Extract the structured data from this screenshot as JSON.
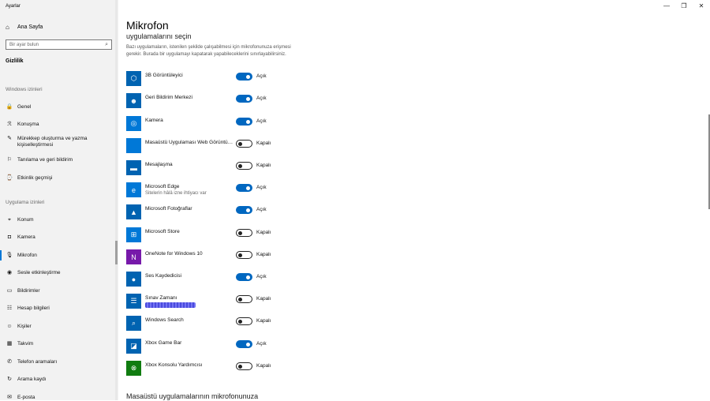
{
  "app_title": "Ayarlar",
  "sidebar": {
    "home_label": "Ana Sayfa",
    "search_placeholder": "Bir ayar bulun",
    "section": "Gizlilik",
    "group_windows": "Windows izinleri",
    "windows_items": [
      {
        "label": "Genel",
        "icon": "lock-icon"
      },
      {
        "label": "Konuşma",
        "icon": "speech-icon"
      },
      {
        "label": "Mürekkep oluşturma ve yazma kişiselleştirmesi",
        "icon": "pen-icon"
      },
      {
        "label": "Tanılama ve geri bildirim",
        "icon": "feedback-icon"
      },
      {
        "label": "Etkinlik geçmişi",
        "icon": "history-icon"
      }
    ],
    "group_apps": "Uygulama izinleri",
    "app_items": [
      {
        "label": "Konum",
        "icon": "location-icon"
      },
      {
        "label": "Kamera",
        "icon": "camera-icon"
      },
      {
        "label": "Mikrofon",
        "icon": "microphone-icon",
        "active": true
      },
      {
        "label": "Sesle etkinleştirme",
        "icon": "voice-icon"
      },
      {
        "label": "Bildirimler",
        "icon": "notification-icon"
      },
      {
        "label": "Hesap bilgileri",
        "icon": "account-icon"
      },
      {
        "label": "Kişiler",
        "icon": "contacts-icon"
      },
      {
        "label": "Takvim",
        "icon": "calendar-icon"
      },
      {
        "label": "Telefon aramaları",
        "icon": "phone-icon"
      },
      {
        "label": "Arama kaydı",
        "icon": "call-history-icon"
      },
      {
        "label": "E-posta",
        "icon": "mail-icon"
      }
    ]
  },
  "main": {
    "title": "Mikrofon",
    "section_head": "uygulamalarını seçin",
    "description": "Bazı uygulamaların, istenilen şekilde çalışabilmesi için mikrofonunuza erişmesi gerekir. Burada bir uygulamayı kapatarak yapabileceklerini sınırlayabilirsiniz.",
    "apps": [
      {
        "name": "3B Görüntüleyici",
        "state": "Açık",
        "on": true,
        "icon": "cube-icon",
        "color": "#0063b1"
      },
      {
        "name": "Geri Bildirim Merkezi",
        "state": "Açık",
        "on": true,
        "icon": "feedback-hub-icon",
        "color": "#0063b1"
      },
      {
        "name": "Kamera",
        "state": "Açık",
        "on": true,
        "icon": "camera-app-icon",
        "color": "#0078d7"
      },
      {
        "name": "Masaüstü Uygulaması Web Görüntü…",
        "state": "Kapalı",
        "on": false,
        "icon": "desktop-app-icon",
        "color": "#0078d7"
      },
      {
        "name": "Mesajlaşma",
        "state": "Kapalı",
        "on": false,
        "icon": "messaging-icon",
        "color": "#0063b1"
      },
      {
        "name": "Microsoft Edge",
        "sub": "Sitelerin hâlâ izne ihtiyacı var",
        "state": "Açık",
        "on": true,
        "icon": "edge-icon",
        "color": "#0078d7"
      },
      {
        "name": "Microsoft Fotoğraflar",
        "state": "Açık",
        "on": true,
        "icon": "photos-icon",
        "color": "#0063b1"
      },
      {
        "name": "Microsoft Store",
        "state": "Kapalı",
        "on": false,
        "icon": "store-icon",
        "color": "#0078d7"
      },
      {
        "name": "OneNote for Windows 10",
        "state": "Kapalı",
        "on": false,
        "icon": "onenote-icon",
        "color": "#7719aa"
      },
      {
        "name": "Ses Kaydedicisi",
        "state": "Açık",
        "on": true,
        "icon": "voice-recorder-icon",
        "color": "#0063b1"
      },
      {
        "name": "Sınav Zamanı",
        "state": "Kapalı",
        "on": false,
        "icon": "exam-icon",
        "color": "#0063b1",
        "redacted": true
      },
      {
        "name": "Windows Search",
        "state": "Kapalı",
        "on": false,
        "icon": "search-app-icon",
        "color": "#0063b1"
      },
      {
        "name": "Xbox Game Bar",
        "state": "Açık",
        "on": true,
        "icon": "xbox-game-bar-icon",
        "color": "#0063b1"
      },
      {
        "name": "Xbox Konsolu Yardımcısı",
        "state": "Kapalı",
        "on": false,
        "icon": "xbox-icon",
        "color": "#107c10"
      }
    ],
    "bottom_head": "Masaüstü uygulamalarının mikrofonunuza"
  },
  "window_controls": {
    "minimize": "—",
    "restore": "❐",
    "close": "✕"
  }
}
